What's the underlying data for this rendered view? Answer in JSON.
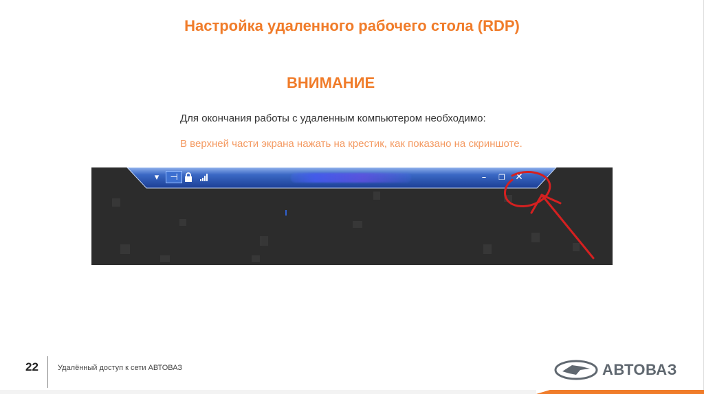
{
  "slide": {
    "title": "Настройка удаленного рабочего стола (RDP)",
    "attention": "ВНИМАНИЕ",
    "instruction": "Для окончания работы с удаленным компьютером необходимо:",
    "step": "В верхней части экрана нажать на крестик, как показано на скриншоте."
  },
  "screenshot": {
    "toolbar": {
      "dropdown_icon": "▾",
      "pin_icon": "⊣",
      "lock_icon": "🔒",
      "signal_icon": "▂▄▆",
      "minimize_icon": "–",
      "restore_icon": "❐",
      "close_icon": "✕"
    }
  },
  "footer": {
    "page_number": "22",
    "caption": "Удалённый доступ к сети АВТОВАЗ",
    "logo_text": "АВТОВАЗ"
  },
  "colors": {
    "accent_orange": "#f07c2a",
    "step_text": "#f49a62",
    "annotation_red": "#d42020",
    "rdp_bar_blue": "#2a58b8"
  }
}
